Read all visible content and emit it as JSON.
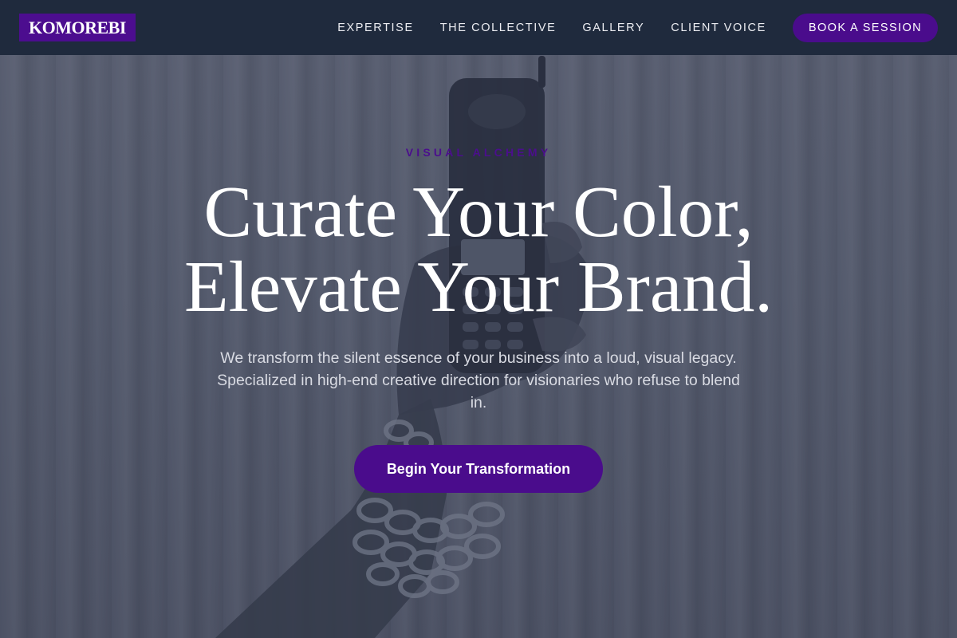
{
  "nav": {
    "logo": "KOMOREBI",
    "links": [
      {
        "label": "EXPERTISE"
      },
      {
        "label": "THE COLLECTIVE"
      },
      {
        "label": "GALLERY"
      },
      {
        "label": "CLIENT VOICE"
      }
    ],
    "cta_label": "BOOK A SESSION"
  },
  "hero": {
    "eyebrow": "VISUAL ALCHEMY",
    "headline_line1": "Curate Your Color,",
    "headline_line2": "Elevate Your Brand.",
    "subtext": "We transform the silent essence of your business into a loud, visual legacy. Specialized in high-end creative direction for visionaries who refuse to blend in.",
    "cta_label": "Begin Your Transformation"
  },
  "colors": {
    "nav_background": "#1f2a3d",
    "accent_purple": "#4a0c8c",
    "hero_text": "#ffffff"
  },
  "icons": {
    "hero_image": "hand-holding-retro-phone-image"
  }
}
